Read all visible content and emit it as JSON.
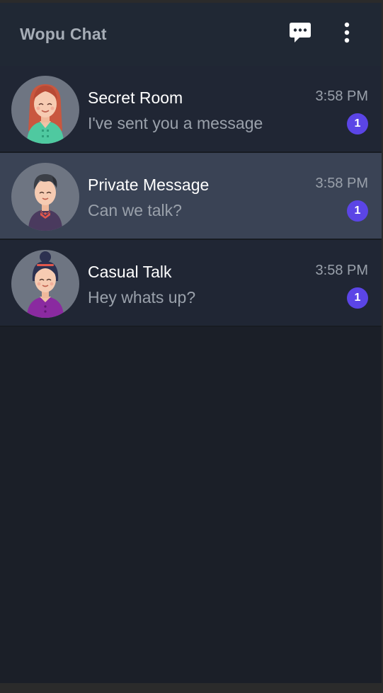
{
  "app": {
    "title": "Wopu Chat"
  },
  "header": {
    "new_chat_icon": "chat-bubble-icon",
    "menu_icon": "more-vertical-icon"
  },
  "colors": {
    "accent": "#5b45e6",
    "header_bg": "#202834",
    "list_bg": "#202634",
    "selected_bg": "#3a4355",
    "app_bg": "#1b1f28"
  },
  "chats": [
    {
      "name": "Secret Room",
      "preview": "I've sent you a message",
      "time": "3:58 PM",
      "unread": "1",
      "selected": false
    },
    {
      "name": "Private Message",
      "preview": "Can we talk?",
      "time": "3:58 PM",
      "unread": "1",
      "selected": true
    },
    {
      "name": "Casual Talk",
      "preview": "Hey whats up?",
      "time": "3:58 PM",
      "unread": "1",
      "selected": false
    }
  ]
}
